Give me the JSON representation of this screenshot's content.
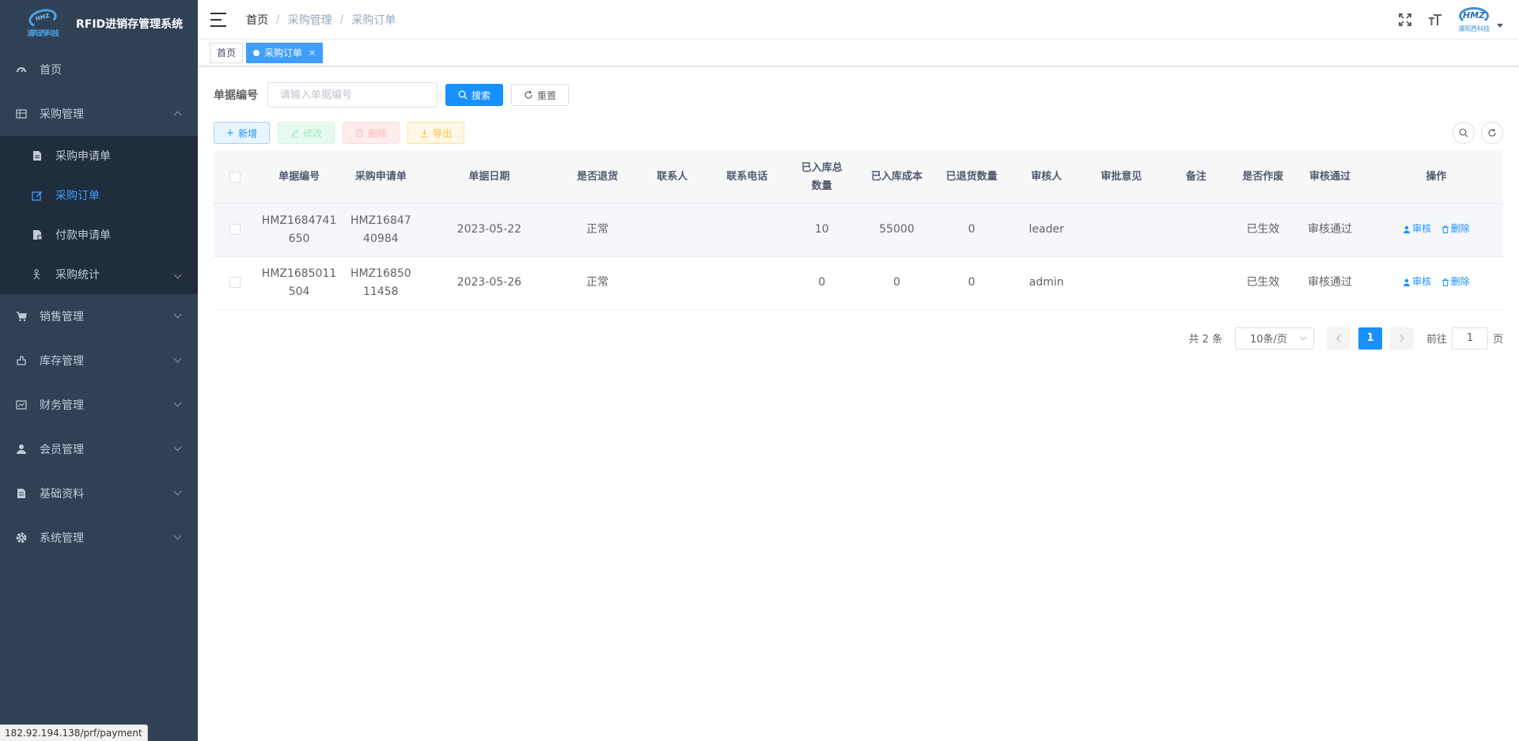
{
  "app": {
    "title": "RFID进销存管理系统",
    "logo_text": "HMZ",
    "logo_sub": "浦阳西科技"
  },
  "sidebar": {
    "items": [
      {
        "label": "首页",
        "icon": "dashboard-icon"
      },
      {
        "label": "采购管理",
        "icon": "table-icon",
        "expanded": true,
        "children": [
          {
            "label": "采购申请单",
            "icon": "document-icon"
          },
          {
            "label": "采购订单",
            "icon": "edit-icon",
            "active": true
          },
          {
            "label": "付款申请单",
            "icon": "form-icon"
          },
          {
            "label": "采购统计",
            "icon": "stats-icon"
          }
        ]
      },
      {
        "label": "销售管理",
        "icon": "cart-icon"
      },
      {
        "label": "库存管理",
        "icon": "box-icon"
      },
      {
        "label": "财务管理",
        "icon": "finance-icon"
      },
      {
        "label": "会员管理",
        "icon": "user-icon"
      },
      {
        "label": "基础资料",
        "icon": "data-icon"
      },
      {
        "label": "系统管理",
        "icon": "gear-icon"
      }
    ]
  },
  "navbar": {
    "breadcrumb": [
      "首页",
      "采购管理",
      "采购订单"
    ]
  },
  "tags": [
    {
      "label": "首页"
    },
    {
      "label": "采购订单",
      "active": true
    }
  ],
  "search": {
    "label": "单据编号",
    "placeholder": "请输入单据编号",
    "search_btn": "搜索",
    "reset_btn": "重置"
  },
  "toolbar": {
    "add": "新增",
    "edit": "修改",
    "delete": "删除",
    "export": "导出"
  },
  "table": {
    "headers": [
      "单据编号",
      "采购申请单",
      "单据日期",
      "是否退货",
      "联系人",
      "联系电话",
      "已入库总数量",
      "已入库成本",
      "已退货数量",
      "审核人",
      "审批意见",
      "备注",
      "是否作废",
      "审核通过",
      "操作"
    ],
    "rows": [
      {
        "code_a": "HMZ1684741",
        "code_b": "650",
        "req_a": "HMZ16847",
        "req_b": "40984",
        "date": "2023-05-22",
        "returned": "正常",
        "contact": "",
        "phone": "",
        "qty": "10",
        "cost": "55000",
        "ret_qty": "0",
        "auditor": "leader",
        "opinion": "",
        "remark": "",
        "void": "已生效",
        "approved": "审核通过"
      },
      {
        "code_a": "HMZ1685011",
        "code_b": "504",
        "req_a": "HMZ16850",
        "req_b": "11458",
        "date": "2023-05-26",
        "returned": "正常",
        "contact": "",
        "phone": "",
        "qty": "0",
        "cost": "0",
        "ret_qty": "0",
        "auditor": "admin",
        "opinion": "",
        "remark": "",
        "void": "已生效",
        "approved": "审核通过"
      }
    ],
    "op_audit": "审核",
    "op_delete": "删除"
  },
  "pagination": {
    "total": "共 2 条",
    "page_size": "10条/页",
    "current": "1",
    "goto_prefix": "前往",
    "goto_value": "1",
    "goto_suffix": "页"
  },
  "status_url": "182.92.194.138/prf/payment",
  "colors": {
    "sidebar_bg": "#304156",
    "submenu_bg": "#1f2d3d",
    "primary": "#1890ff",
    "success_text": "#1e9a3c"
  }
}
